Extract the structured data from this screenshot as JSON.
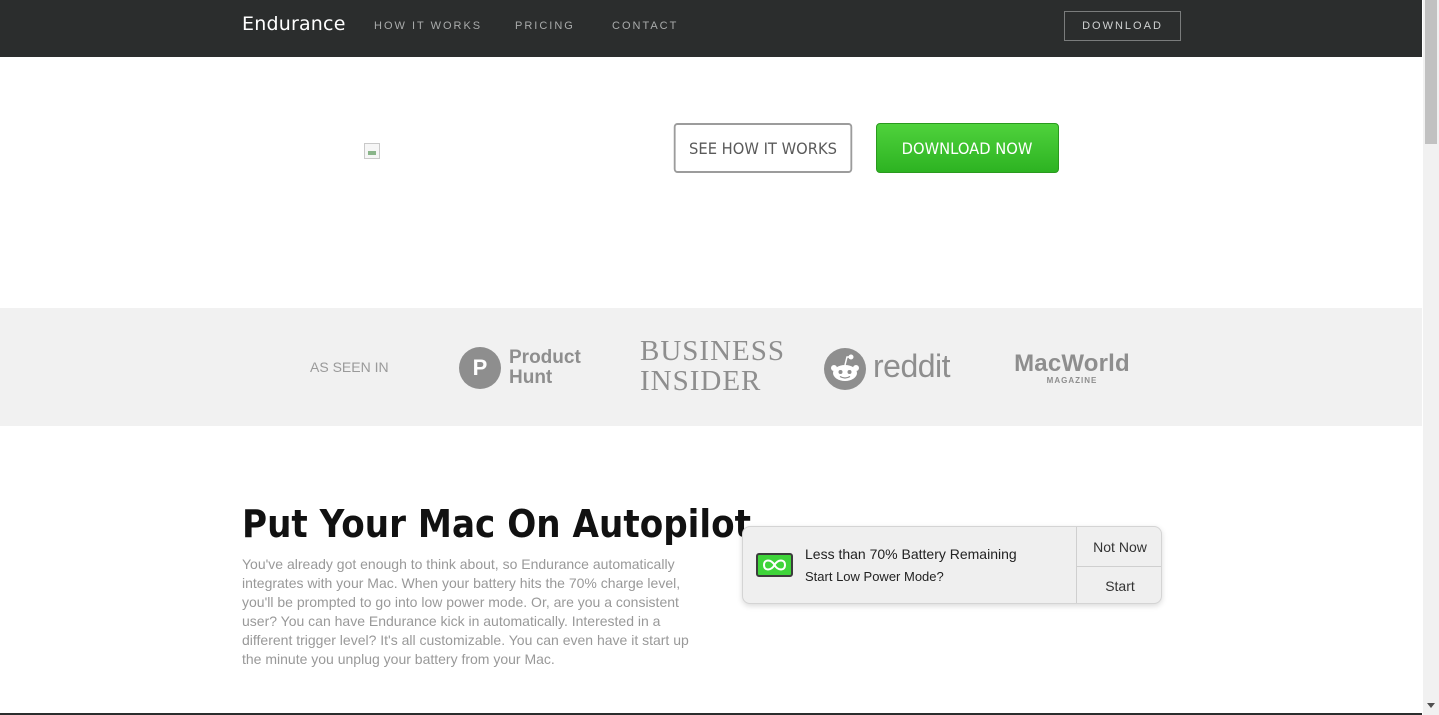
{
  "nav": {
    "brand": "Endurance",
    "links": [
      "HOW IT WORKS",
      "PRICING",
      "CONTACT"
    ],
    "download": "DOWNLOAD"
  },
  "hero": {
    "see_how": "SEE HOW IT WORKS",
    "download_now": "DOWNLOAD NOW"
  },
  "press": {
    "label": "AS SEEN IN",
    "producthunt": {
      "mark": "P",
      "line1": "Product",
      "line2": "Hunt"
    },
    "businessinsider": {
      "line1": "BUSINESS",
      "line2": "INSIDER"
    },
    "reddit": "reddit",
    "macworld": {
      "title": "MacWorld",
      "sub": "MAGAZINE"
    }
  },
  "feature": {
    "title": "Put Your Mac On Autopilot",
    "body": "You've already got enough to think about, so Endurance automatically integrates with your Mac. When your battery hits the 70% charge level, you'll be prompted to go into low power mode. Or, are you a consistent user? You can have Endurance kick in automatically. Interested in a different trigger level? It's all customizable. You can even have it start up the minute you unplug your battery from your Mac."
  },
  "notification": {
    "title": "Less than 70% Battery Remaining",
    "subtitle": "Start Low Power Mode?",
    "not_now": "Not Now",
    "start": "Start"
  },
  "colors": {
    "nav_bg": "#2b2d2d",
    "accent_green": "#3cc22e",
    "press_bg": "#f1f1f1"
  }
}
